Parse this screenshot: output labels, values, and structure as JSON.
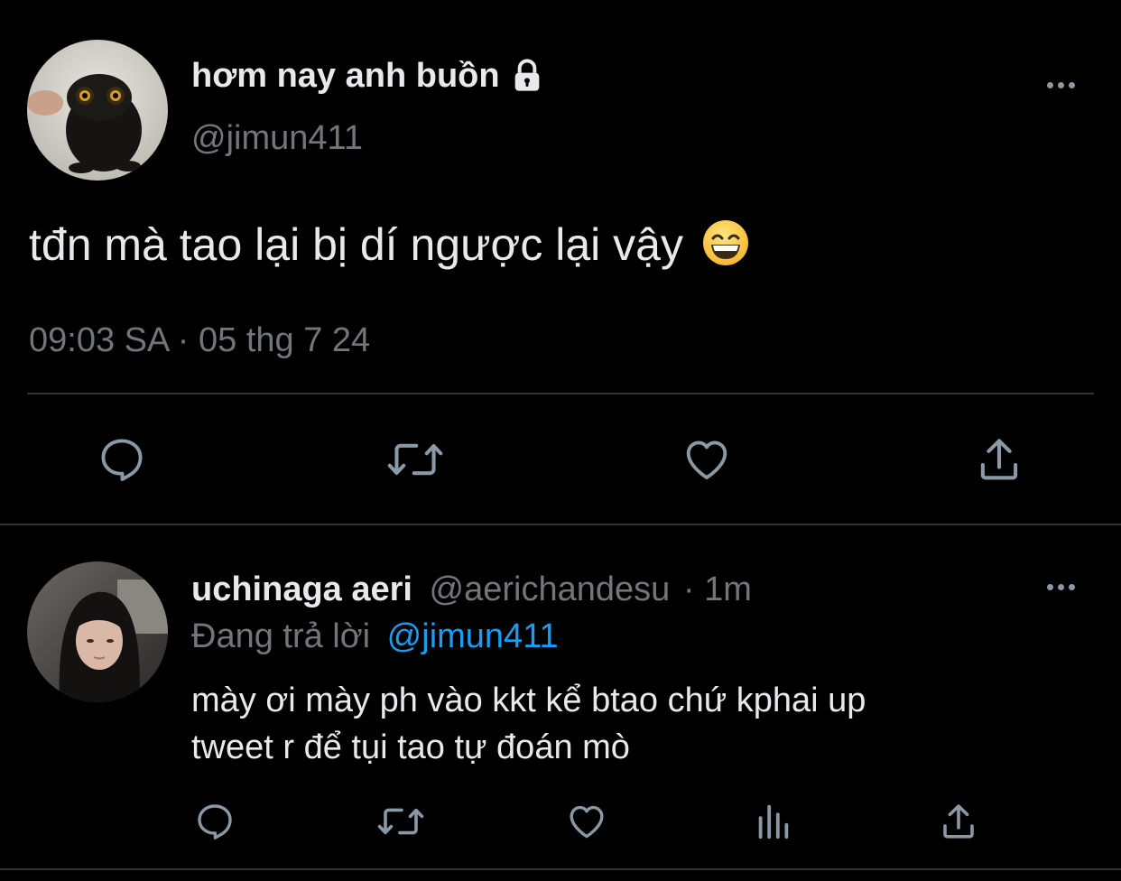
{
  "tweet": {
    "display_name": "hơm nay anh buồn",
    "protected_icon": "lock-icon",
    "handle": "@jimun411",
    "text": "tđn mà tao lại bị dí ngược lại vậy",
    "emoji": "😄",
    "timestamp": "09:03 SA · 05 thg 7 24",
    "actions": [
      "reply-icon",
      "retweet-icon",
      "like-icon",
      "share-icon"
    ]
  },
  "reply": {
    "display_name": "uchinaga aeri",
    "handle": "@aerichandesu",
    "time": "· 1m",
    "replying_label": "Đang trả lời",
    "replying_to": "@jimun411",
    "text_line1": "mày ơi mày ph vào kkt kể btao chứ kphai up",
    "text_line2": "tweet r để tụi tao tự đoán mò",
    "actions": [
      "reply-icon",
      "retweet-icon",
      "like-icon",
      "views-icon",
      "share-icon"
    ]
  },
  "colors": {
    "background": "#000000",
    "text": "#e7e9ea",
    "muted": "#71767b",
    "link": "#1d9bf0",
    "divider": "#2f3336"
  }
}
